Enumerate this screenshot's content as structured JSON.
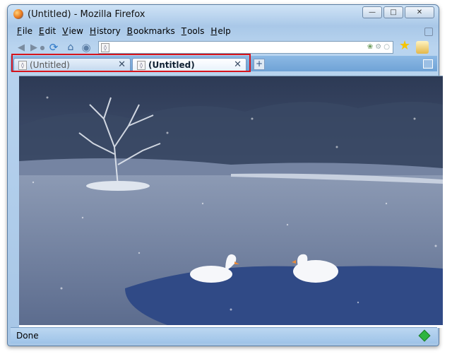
{
  "window": {
    "title": "(Untitled) - Mozilla Firefox",
    "controls": [
      "minimize",
      "maximize",
      "close"
    ]
  },
  "menu": {
    "items": [
      {
        "label": "File",
        "accel": "F",
        "rest": "ile"
      },
      {
        "label": "Edit",
        "accel": "E",
        "rest": "dit"
      },
      {
        "label": "View",
        "accel": "V",
        "rest": "iew"
      },
      {
        "label": "History",
        "accel": "H",
        "rest": "istory"
      },
      {
        "label": "Bookmarks",
        "accel": "B",
        "rest": "ookmarks"
      },
      {
        "label": "Tools",
        "accel": "T",
        "rest": "ools"
      },
      {
        "label": "Help",
        "accel": "H",
        "rest": "elp"
      }
    ]
  },
  "toolbar": {
    "icons": [
      "back-icon",
      "forward-icon",
      "history-dropdown-icon",
      "reload-icon",
      "home-icon",
      "stop-icon"
    ],
    "url": ""
  },
  "tabs": [
    {
      "label": "(Untitled)",
      "active": false
    },
    {
      "label": "(Untitled)",
      "active": true
    }
  ],
  "content": {
    "image": "snowy lake with two swans"
  },
  "status": {
    "text": "Done"
  },
  "colors": {
    "highlight": "#d6141c",
    "chrome": "#a9c8e8"
  }
}
